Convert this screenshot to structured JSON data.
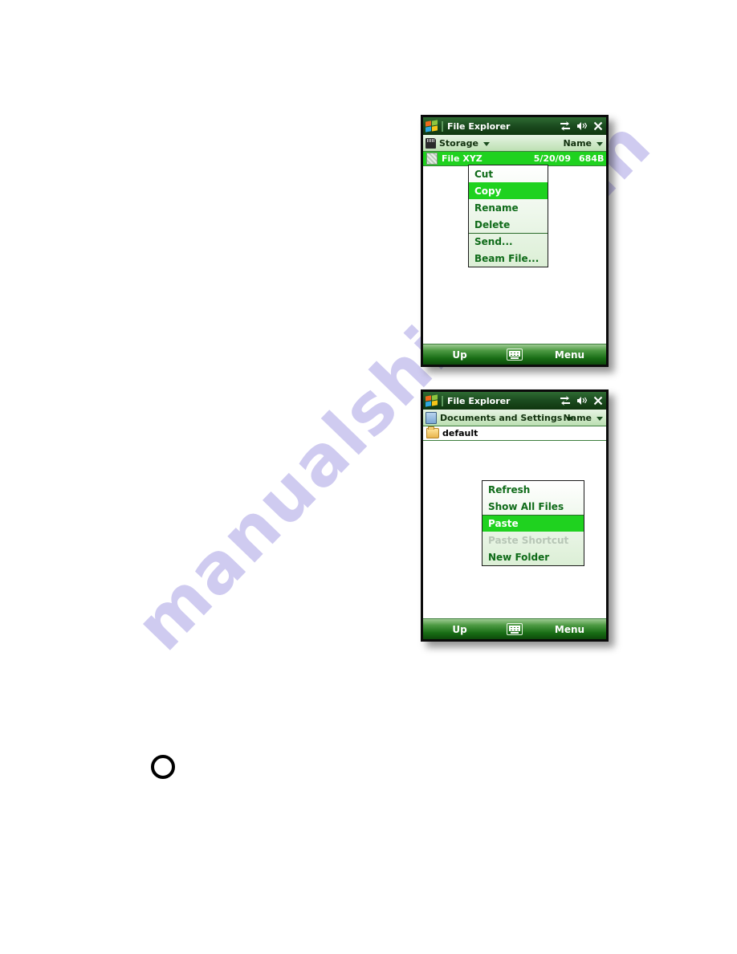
{
  "page": {
    "background_color": "#ffffff",
    "watermark_text": "manualshive.com",
    "watermark_color": "#cfcbf0",
    "callout_marker": ""
  },
  "colors": {
    "titlebar_dark_green": "#1b4c1f",
    "highlight_green": "#1fd21f",
    "menu_text_green": "#0f6b19",
    "toolbar_light_green": "#cfe9c8",
    "disabled_grey": "#b7c6b6"
  },
  "screenshots": [
    {
      "id": "file-explorer-storage",
      "titlebar": {
        "app_title": "File Explorer",
        "logo_icon": "windows-flag-icon",
        "status_icons": [
          "connectivity-icon",
          "volume-icon",
          "close-icon"
        ]
      },
      "toolbar": {
        "location_icon": "storage-card-icon",
        "location_label": "Storage",
        "location_caret": "chevron-down-icon",
        "sort_label": "Name",
        "sort_caret": "chevron-down-icon"
      },
      "files": [
        {
          "icon": "file-icon",
          "name": "File XYZ",
          "date": "5/20/09",
          "size": "684B",
          "selected": true
        }
      ],
      "context_menu": {
        "items": [
          {
            "label": "Cut",
            "highlighted": false,
            "disabled": false,
            "separator_above": false
          },
          {
            "label": "Copy",
            "highlighted": true,
            "disabled": false,
            "separator_above": false
          },
          {
            "label": "Rename",
            "highlighted": false,
            "disabled": false,
            "separator_above": false
          },
          {
            "label": "Delete",
            "highlighted": false,
            "disabled": false,
            "separator_above": false
          },
          {
            "label": "Send...",
            "highlighted": false,
            "disabled": false,
            "separator_above": true
          },
          {
            "label": "Beam File...",
            "highlighted": false,
            "disabled": false,
            "separator_above": false
          }
        ]
      },
      "command_bar": {
        "left_label": "Up",
        "center_icon": "keyboard-icon",
        "right_label": "Menu"
      }
    },
    {
      "id": "file-explorer-documents-and-settings",
      "titlebar": {
        "app_title": "File Explorer",
        "logo_icon": "windows-flag-icon",
        "status_icons": [
          "connectivity-icon",
          "volume-icon",
          "close-icon"
        ]
      },
      "toolbar": {
        "location_icon": "device-icon",
        "location_label": "Documents and Settings",
        "location_caret": "chevron-down-icon",
        "sort_label": "Name",
        "sort_caret": "chevron-down-icon"
      },
      "files": [
        {
          "icon": "folder-icon",
          "name": "default",
          "date": "",
          "size": "",
          "selected": false
        }
      ],
      "context_menu": {
        "items": [
          {
            "label": "Refresh",
            "highlighted": false,
            "disabled": false,
            "separator_above": false
          },
          {
            "label": "Show All Files",
            "highlighted": false,
            "disabled": false,
            "separator_above": false
          },
          {
            "label": "Paste",
            "highlighted": true,
            "disabled": false,
            "separator_above": true
          },
          {
            "label": "Paste Shortcut",
            "highlighted": false,
            "disabled": true,
            "separator_above": false
          },
          {
            "label": "New Folder",
            "highlighted": false,
            "disabled": false,
            "separator_above": false
          }
        ]
      },
      "command_bar": {
        "left_label": "Up",
        "center_icon": "keyboard-icon",
        "right_label": "Menu"
      }
    }
  ]
}
